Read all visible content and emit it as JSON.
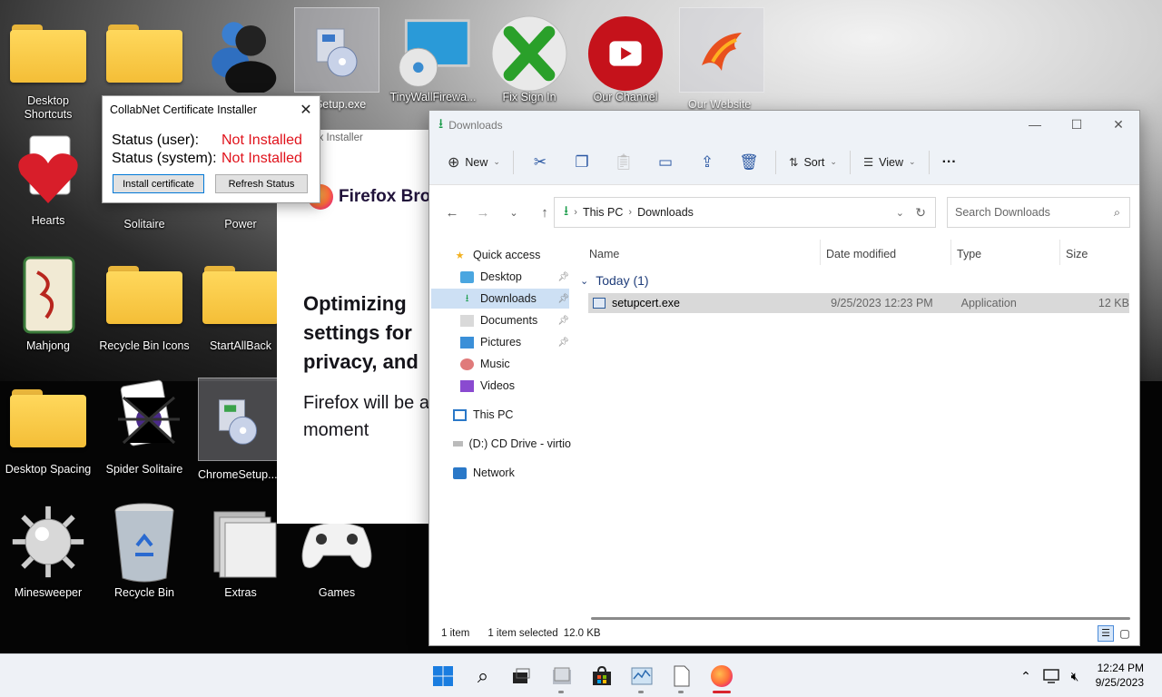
{
  "desktop": {
    "icons": [
      {
        "label": "Desktop\nShortcuts",
        "name": "desktop-shortcuts-folder"
      },
      {
        "label": "",
        "name": "folder-2"
      },
      {
        "label": "",
        "name": "messenger-people"
      },
      {
        "label": "eSetup.exe",
        "name": "setup-exe-icon"
      },
      {
        "label": "TinyWallFirewa...",
        "name": "tinywall-icon"
      },
      {
        "label": "Fix Sign In",
        "name": "fix-sign-in-icon"
      },
      {
        "label": "Our Channel",
        "name": "our-channel-icon"
      },
      {
        "label": "Our Website",
        "name": "our-website-icon"
      },
      {
        "label": "Hearts",
        "name": "hearts-icon"
      },
      {
        "label": "Solitaire",
        "name": "solitaire-icon"
      },
      {
        "label": "Power",
        "name": "power-icon"
      },
      {
        "label": "Mahjong",
        "name": "mahjong-icon"
      },
      {
        "label": "Recycle Bin Icons",
        "name": "recycle-bin-icons-folder"
      },
      {
        "label": "StartAllBack",
        "name": "startallback-folder"
      },
      {
        "label": "Desktop Spacing",
        "name": "desktop-spacing-folder"
      },
      {
        "label": "Spider Solitaire",
        "name": "spider-solitaire-icon"
      },
      {
        "label": "ChromeSetup...",
        "name": "chromesetup-icon"
      },
      {
        "label": "Minesweeper",
        "name": "minesweeper-icon"
      },
      {
        "label": "Recycle Bin",
        "name": "recycle-bin-icon"
      },
      {
        "label": "Extras",
        "name": "extras-icon"
      },
      {
        "label": "Games",
        "name": "games-icon"
      }
    ]
  },
  "cert_installer": {
    "title": "CollabNet Certificate Installer",
    "status_user_label": "Status (user):",
    "status_user_value": "Not Installed",
    "status_system_label": "Status (system):",
    "status_system_value": "Not Installed",
    "install_button": "Install certificate",
    "refresh_button": "Refresh Status"
  },
  "firefox_installer": {
    "title": "fox Installer",
    "brand": "Firefox Brow",
    "heading": "Optimizing settings for privacy, and",
    "body": "Firefox will be a few moment"
  },
  "explorer": {
    "title": "Downloads",
    "cmd": {
      "new": "New",
      "sort": "Sort",
      "view": "View",
      "more": "···"
    },
    "breadcrumb": [
      "This PC",
      "Downloads"
    ],
    "search_placeholder": "Search Downloads",
    "nav": {
      "quick_access": "Quick access",
      "desktop": "Desktop",
      "downloads": "Downloads",
      "documents": "Documents",
      "pictures": "Pictures",
      "music": "Music",
      "videos": "Videos",
      "this_pc": "This PC",
      "cd_drive": "(D:) CD Drive - virtio",
      "network": "Network"
    },
    "columns": {
      "name": "Name",
      "date": "Date modified",
      "type": "Type",
      "size": "Size"
    },
    "group": "Today (1)",
    "file": {
      "name": "setupcert.exe",
      "date": "9/25/2023 12:23 PM",
      "type": "Application",
      "size": "12 KB"
    },
    "status": {
      "count": "1 item",
      "selected": "1 item selected",
      "size": "12.0 KB"
    }
  },
  "taskbar": {
    "time": "12:24 PM",
    "date": "9/25/2023"
  }
}
